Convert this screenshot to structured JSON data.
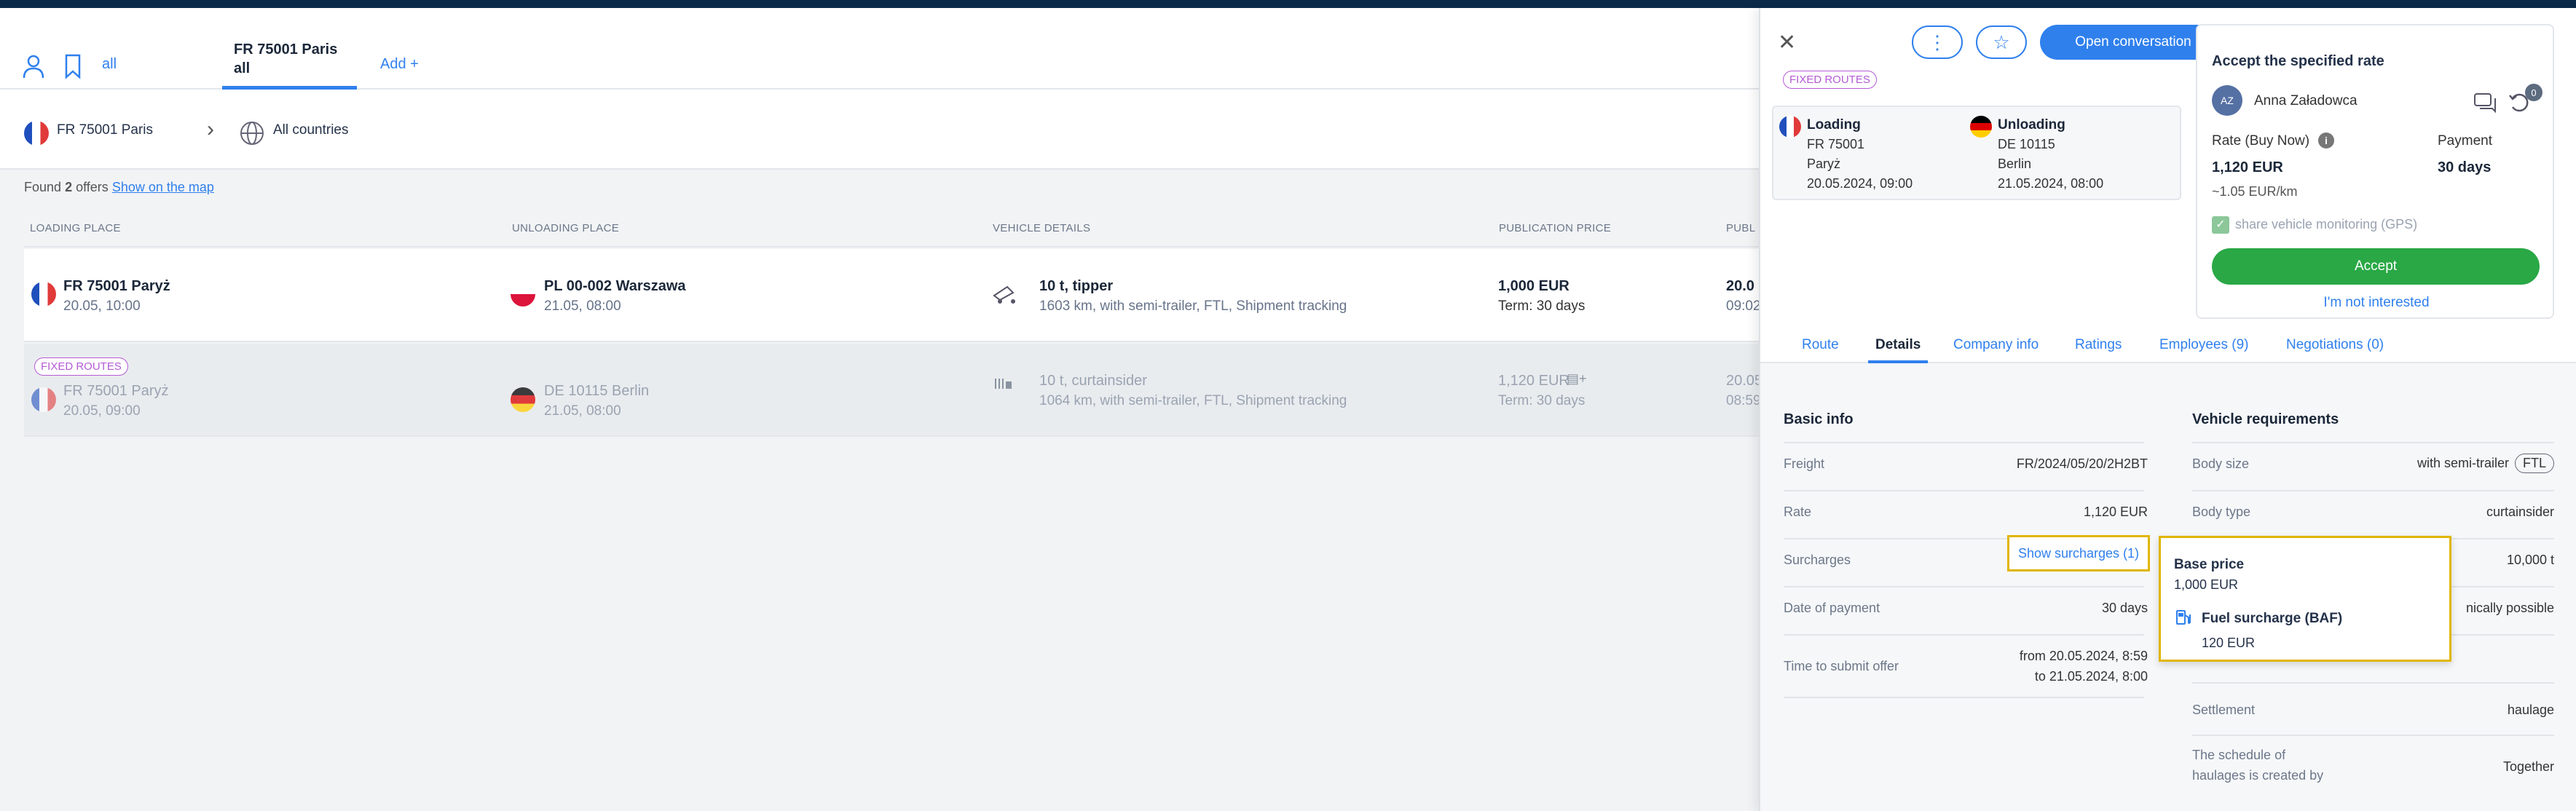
{
  "tabs": {
    "all_label": "all",
    "active_line1": "FR 75001 Paris",
    "active_line2": "all",
    "add_label": "Add +"
  },
  "route": {
    "from": "FR 75001 Paris",
    "to": "All countries"
  },
  "found": {
    "prefix": "Found",
    "count": "2",
    "suffix": "offers",
    "map_link": "Show on the map"
  },
  "table": {
    "headers": [
      "LOADING PLACE",
      "UNLOADING PLACE",
      "VEHICLE DETAILS",
      "PUBLICATION PRICE",
      "PUBL"
    ],
    "rows": [
      {
        "badge": "",
        "load": "FR 75001 Paryż",
        "load_date": "20.05, 10:00",
        "unload": "PL 00-002 Warszawa",
        "unload_date": "21.05, 08:00",
        "vehicle": "10 t, tipper",
        "vehicle_sub": "1603 km, with semi-trailer, FTL, Shipment tracking",
        "price": "1,000 EUR",
        "term": "Term: 30 days",
        "pub": "20.0",
        "pub_sub": "09:02"
      },
      {
        "badge": "FIXED ROUTES",
        "load": "FR 75001 Paryż",
        "load_date": "20.05, 09:00",
        "unload": "DE 10115 Berlin",
        "unload_date": "21.05, 08:00",
        "vehicle": "10 t, curtainsider",
        "vehicle_sub": "1064 km, with semi-trailer, FTL, Shipment tracking",
        "price": "1,120 EUR",
        "term": "Term: 30 days",
        "pub": "20.05",
        "pub_sub": "08:59"
      }
    ]
  },
  "panel": {
    "fixed_badge": "FIXED ROUTES",
    "open_conversation": "Open conversation",
    "loading": {
      "title": "Loading",
      "code": "FR 75001",
      "city": "Paryż",
      "date": "20.05.2024, 09:00"
    },
    "unloading": {
      "title": "Unloading",
      "code": "DE 10115",
      "city": "Berlin",
      "date": "21.05.2024, 08:00"
    },
    "accept": {
      "title": "Accept the specified rate",
      "avatar": "AZ",
      "name": "Anna Załadowca",
      "badge": "0",
      "rate_label": "Rate (Buy Now)",
      "rate_value": "1,120 EUR",
      "per_km": "~1.05 EUR/km",
      "payment_label": "Payment",
      "payment_value": "30 days",
      "gps": "share vehicle monitoring (GPS)",
      "accept_btn": "Accept",
      "not_interested": "I'm not interested"
    },
    "tabs": [
      "Route",
      "Details",
      "Company info",
      "Ratings",
      "Employees (9)",
      "Negotiations (0)"
    ],
    "basic": {
      "title": "Basic info",
      "freight_l": "Freight",
      "freight_v": "FR/2024/05/20/2H2BT",
      "rate_l": "Rate",
      "rate_v": "1,120 EUR",
      "surch_l": "Surcharges",
      "surch_btn": "Show surcharges (1)",
      "date_l": "Date of payment",
      "date_v": "30 days",
      "submit_l": "Time to submit offer",
      "submit_v1": "from 20.05.2024, 8:59",
      "submit_v2": "to 21.05.2024, 8:00"
    },
    "vehicle": {
      "title": "Vehicle requirements",
      "size_l": "Body size",
      "size_v": "with semi-trailer",
      "size_tag": "FTL",
      "type_l": "Body type",
      "type_v": "curtainsider",
      "cap_v": "10,000 t",
      "poss_v": "nically possible",
      "settle_l": "Settlement",
      "settle_v": "haulage",
      "sched_l1": "The schedule of",
      "sched_l2": "haulages is created by",
      "sched_v": "Together"
    },
    "tooltip": {
      "base_l": "Base price",
      "base_v": "1,000 EUR",
      "fuel_l": "Fuel surcharge (BAF)",
      "fuel_v": "120 EUR"
    }
  }
}
